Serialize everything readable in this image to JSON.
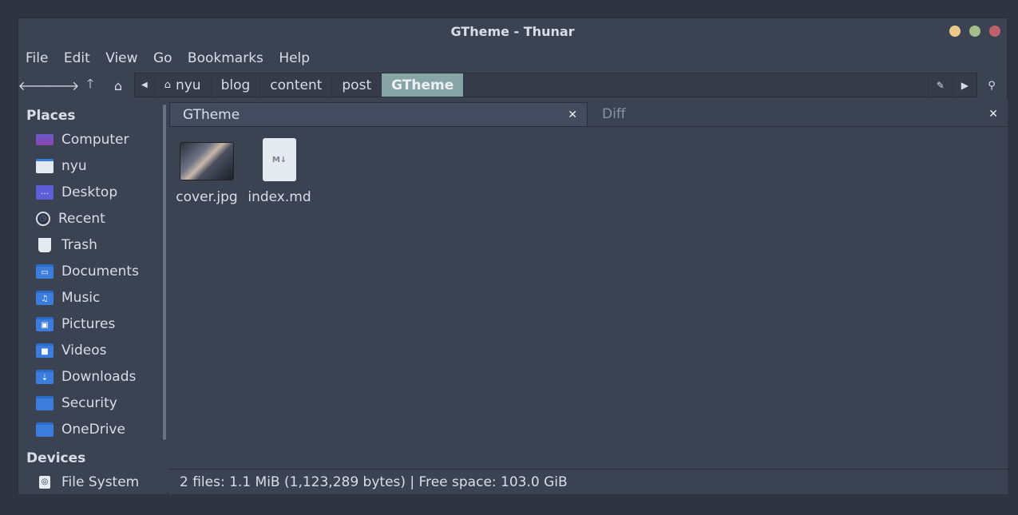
{
  "window": {
    "title": "GTheme - Thunar"
  },
  "menu": [
    "File",
    "Edit",
    "View",
    "Go",
    "Bookmarks",
    "Help"
  ],
  "path": [
    "nyu",
    "blog",
    "content",
    "post",
    "GTheme"
  ],
  "sidebar": {
    "places_heading": "Places",
    "places": [
      {
        "label": "Computer",
        "icon": "computer-icon"
      },
      {
        "label": "nyu",
        "icon": "home-folder-icon"
      },
      {
        "label": "Desktop",
        "icon": "desktop-icon"
      },
      {
        "label": "Recent",
        "icon": "recent-icon"
      },
      {
        "label": "Trash",
        "icon": "trash-icon"
      },
      {
        "label": "Documents",
        "icon": "documents-folder-icon"
      },
      {
        "label": "Music",
        "icon": "music-folder-icon"
      },
      {
        "label": "Pictures",
        "icon": "pictures-folder-icon"
      },
      {
        "label": "Videos",
        "icon": "videos-folder-icon"
      },
      {
        "label": "Downloads",
        "icon": "downloads-folder-icon"
      },
      {
        "label": "Security",
        "icon": "folder-icon"
      },
      {
        "label": "OneDrive",
        "icon": "folder-icon"
      }
    ],
    "devices_heading": "Devices",
    "devices": [
      {
        "label": "File System",
        "icon": "drive-icon"
      }
    ]
  },
  "tabs": [
    {
      "label": "GTheme"
    },
    {
      "label": "Diff"
    }
  ],
  "files": [
    {
      "name": "cover.jpg",
      "type": "image"
    },
    {
      "name": "index.md",
      "type": "markdown"
    }
  ],
  "status": "2 files: 1.1 MiB (1,123,289 bytes)  |  Free space: 103.0 GiB",
  "colors": {
    "accent": "#88a5a5",
    "bg": "#3b4252",
    "folder": "#3b7ddd"
  }
}
